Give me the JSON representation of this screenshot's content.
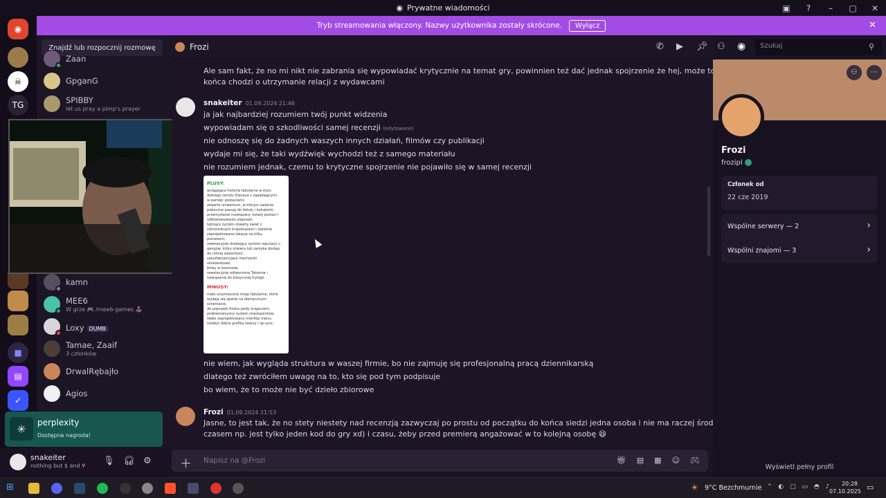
{
  "window": {
    "title": "Prywatne wiadomości"
  },
  "banner": {
    "text": "Tryb streamowania włączony. Nazwy użytkownika zostały skrócone.",
    "button": "Wyłącz"
  },
  "servers": {
    "tg_label": "TG"
  },
  "sidebar": {
    "find": "Znajdź lub rozpocznij rozmowę",
    "dms": [
      {
        "name": "Zaan",
        "sub": ""
      },
      {
        "name": "GpganG",
        "sub": ""
      },
      {
        "name": "SPIBBY",
        "sub": "let us pray a pimp's prayer"
      },
      {
        "name": "kamn",
        "sub": ""
      },
      {
        "name": "MEE6",
        "sub": "W grze  🎮 /mee6-games 🕹️"
      },
      {
        "name": "Loxy",
        "sub": "",
        "tag": "DUMB"
      },
      {
        "name": "Tamae, Zaaif",
        "sub": "3 członków"
      },
      {
        "name": "DrwalRębajło",
        "sub": ""
      },
      {
        "name": "Agios",
        "sub": ""
      }
    ]
  },
  "promo": {
    "title": "perplexity",
    "sub": "Dostępna nagroda!"
  },
  "user": {
    "name": "snakeiter",
    "status": "nothing but $ and ¥"
  },
  "chat": {
    "header_name": "Frozi",
    "search_placeholder": "Szukaj",
    "lines_top": [
      "Ale sam fakt, że no mi nikt nie zabrania się wypowiadać krytycznie na temat gry, powinnien też dać jednak spojrzenie że hej, może to nie do",
      "końca chodzi o utrzymanie relacji z wydawcami"
    ],
    "msg1": {
      "author": "snakeiter",
      "time": "01.09.2024 21:46",
      "lines": [
        "ja jak najbardziej rozumiem twój punkt widzenia",
        "wypowiadam się o szkodliwości samej recenzji",
        "nie odnoszę się do żadnych waszych innych działań, filmów czy publikacji",
        "wydaje mi się, że taki wydźwięk wychodzi też z samego materiału",
        "nie rozumiem jednak, czemu to krytyczne spojrzenie nie pojawiło się w samej recenzji"
      ],
      "edited": "(edytowane)",
      "lines_after": [
        "nie wiem, jak wygląda struktura w waszej firmie, bo nie zajmuję się profesjonalną pracą dziennikarską",
        "dlatego też zwróciłem uwagę na to, kto się pod tym podpisuje",
        "bo wiem, że to może nie być dzieło zbiorowe"
      ]
    },
    "review": {
      "plus_title": "PLUSY:",
      "plus": [
        "wciągająca historia fabularna w stylu",
        "dobrego serialu Disneya z zapadającymi",
        "w pamięć postaciami;",
        "otwarte uniwersum, w którym zadania",
        "poboczne pasują do fabuły i bohaterki;",
        "przemyślanie rozwiązany rozwój postaci i",
        "odblokowywanie ulepszeń;",
        "tętniący życiem otwarty świat z",
        "różnorodnymi krajobrazami i świetnie",
        "zaprojektowane lokacje na kilku",
        "planetach;",
        "rewelacyjnie działający system reputacji u",
        "gangów, który otwiera lub zamyka dostęp",
        "do różnej zawartości;",
        "satysfakcjonujące mechaniki",
        "skradankowe;",
        "bitwy w kosmosie;",
        "rewelacyjnie odtworzone Tatooine i",
        "nawiązania do klasycznej trylogii."
      ],
      "minus_title": "MINUSY:",
      "minus": [
        "mało urozmaicone misje fabularne, które",
        "wydają się oparte na identycznym",
        "schemacie;",
        "do poprawki fizyka jazdy ścigaczem;",
        "problematyczny system checkpointów;",
        "słabo zaprojektowany interfejs menu;",
        "niezbyt dobra grafika twarzy i lip-sync."
      ]
    },
    "msg2": {
      "author": "Frozi",
      "time": "01.09.2024 21:53",
      "lines": [
        "Jasne, to jest tak, że no stety niestety nad recenzją zazwyczaj po prostu od początku do końca siedzi jedna osoba i nie ma raczej środków (bo",
        "czasem np. jest tylko jeden kod do gry xd) i czasu, żeby przed premierą angażować w to kolejną osobę 😄"
      ]
    },
    "composer_placeholder": "Napisz na @Frozi"
  },
  "profile": {
    "name": "Frozi",
    "handle": "frozipl",
    "member_label": "Członek od",
    "member_date": "22 cze 2019",
    "mutual_servers": "Wspólne serwery — 2",
    "mutual_friends": "Wspólni znajomi — 3",
    "full_profile": "Wyświetl pełny profil"
  },
  "taskbar": {
    "weather": "9°C  Bezchmurnie",
    "time": "20:28",
    "date": "07.10.2025"
  }
}
